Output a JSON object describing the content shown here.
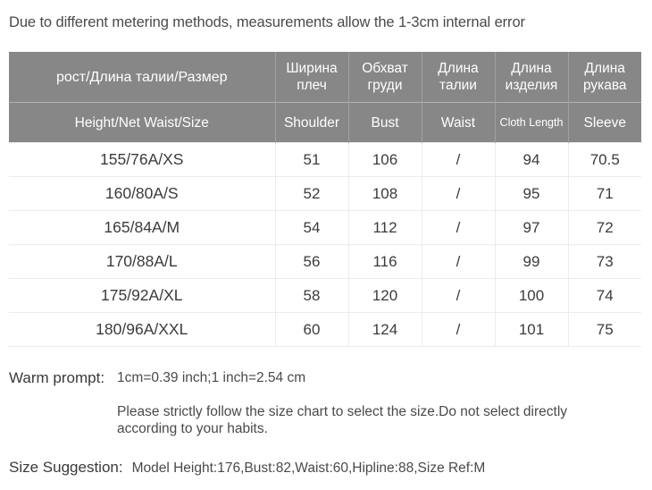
{
  "notice": "Due to different metering methods, measurements allow the 1-3cm internal error",
  "table": {
    "headers_ru": [
      "рост/Длина талии/Размер",
      "Ширина плеч",
      "Обхват груди",
      "Длина талии",
      "Длина изделия",
      "Длина рукава"
    ],
    "headers_en": [
      "Height/Net Waist/Size",
      "Shoulder",
      "Bust",
      "Waist",
      "Cloth Length",
      "Sleeve"
    ],
    "rows": [
      [
        "155/76A/XS",
        "51",
        "106",
        "/",
        "94",
        "70.5"
      ],
      [
        "160/80A/S",
        "52",
        "108",
        "/",
        "95",
        "71"
      ],
      [
        "165/84A/M",
        "54",
        "112",
        "/",
        "97",
        "72"
      ],
      [
        "170/88A/L",
        "56",
        "116",
        "/",
        "99",
        "73"
      ],
      [
        "175/92A/XL",
        "58",
        "120",
        "/",
        "100",
        "74"
      ],
      [
        "180/96A/XXL",
        "60",
        "124",
        "/",
        "101",
        "75"
      ]
    ]
  },
  "warm_prompt": {
    "label": "Warm prompt:",
    "line1": "1cm=0.39 inch;1 inch=2.54 cm",
    "line2": "Please strictly follow the size chart  to select the size.Do not select directly according to your habits."
  },
  "size_suggestion": {
    "label": "Size Suggestion:",
    "value": "Model Height:176,Bust:82,Waist:60,Hipline:88,Size Ref:M"
  },
  "colors": {
    "header_bg": "#878787",
    "header_text": "#ffffff",
    "body_text": "#3d3a3a",
    "grid_line": "#ececec",
    "page_bg": "#ffffff"
  }
}
